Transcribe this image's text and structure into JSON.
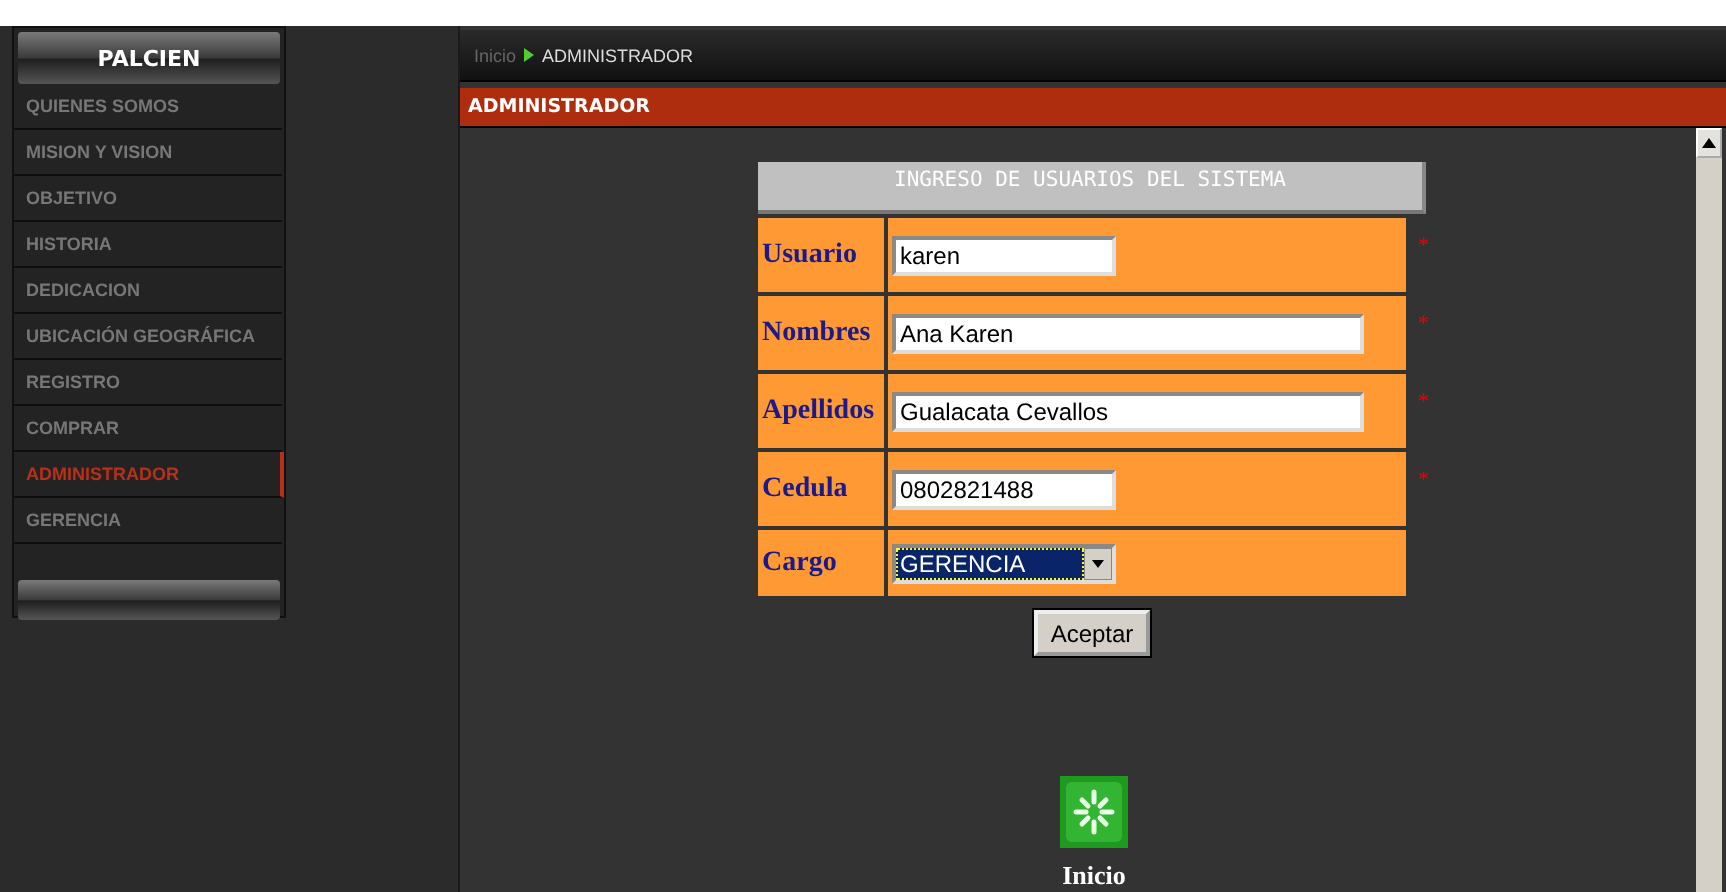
{
  "sidebar": {
    "title": "PALCIEN",
    "items": [
      {
        "label": "QUIENES SOMOS",
        "selected": false
      },
      {
        "label": "MISION Y VISION",
        "selected": false
      },
      {
        "label": "OBJETIVO",
        "selected": false
      },
      {
        "label": "HISTORIA",
        "selected": false
      },
      {
        "label": "DEDICACION",
        "selected": false
      },
      {
        "label": "UBICACIÓN GEOGRÁFICA",
        "selected": false
      },
      {
        "label": "REGISTRO",
        "selected": false
      },
      {
        "label": "COMPRAR",
        "selected": false
      },
      {
        "label": "ADMINISTRADOR",
        "selected": true
      },
      {
        "label": "GERENCIA",
        "selected": false
      }
    ]
  },
  "breadcrumb": {
    "home": "Inicio",
    "current": "ADMINISTRADOR"
  },
  "section_title": "ADMINISTRADOR",
  "form": {
    "title": "INGRESO DE USUARIOS DEL SISTEMA",
    "fields": [
      {
        "kind": "short_text",
        "label": "Usuario",
        "value": "karen",
        "required_mark": "*"
      },
      {
        "kind": "long_text",
        "label": "Nombres",
        "value": "Ana Karen",
        "required_mark": "*"
      },
      {
        "kind": "long_text",
        "label": "Apellidos",
        "value": "Gualacata Cevallos",
        "required_mark": "*"
      },
      {
        "kind": "short_text",
        "label": "Cedula",
        "value": "0802821488",
        "required_mark": "*"
      },
      {
        "kind": "select",
        "label": "Cargo",
        "value": "GERENCIA"
      }
    ],
    "submit": "Aceptar"
  },
  "home_link": {
    "label": "Inicio"
  }
}
